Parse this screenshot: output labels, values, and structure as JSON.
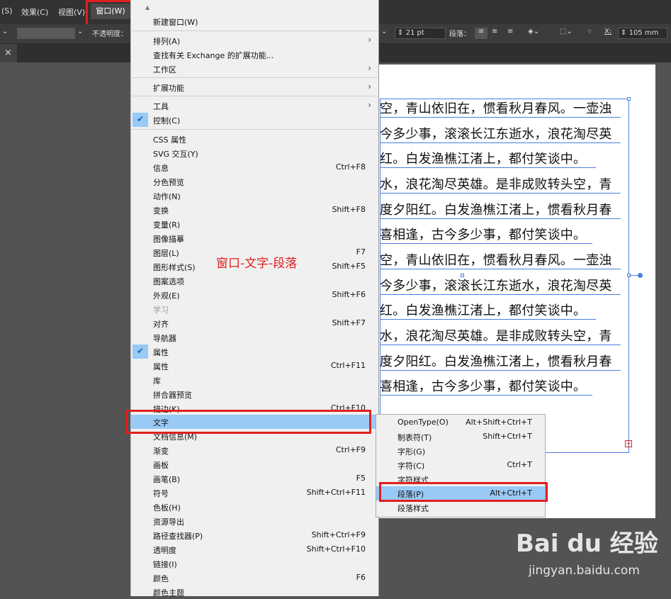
{
  "menubar": {
    "items": [
      "(S)",
      "效果(C)",
      "视图(V)"
    ],
    "window_label": "窗口(W)"
  },
  "controlbar": {
    "opacity_label": "不透明度：",
    "font_size": "21 pt",
    "paragraph_label": "段落：",
    "x_label": "X:",
    "x_value": "105 mm"
  },
  "tab": {
    "close": "×"
  },
  "document_text": [
    "空，青山依旧在，惯看秋月春风。一壶浊",
    "今多少事，滚滚长江东逝水，浪花淘尽英",
    "红。白发渔樵江渚上，都付笑谈中。",
    "水，浪花淘尽英雄。是非成败转头空，青",
    "度夕阳红。白发渔樵江渚上，惯看秋月春",
    "喜相逢，古今多少事，都付笑谈中。",
    "空，青山依旧在，惯看秋月春风。一壶浊",
    "今多少事，滚滚长江东逝水，浪花淘尽英",
    "红。白发渔樵江渚上，都付笑谈中。",
    "水，浪花淘尽英雄。是非成败转头空，青",
    "度夕阳红。白发渔樵江渚上，惯看秋月春",
    "喜相逢，古今多少事，都付笑谈中。"
  ],
  "window_menu": {
    "scroll_up": "▲",
    "items": [
      {
        "label": "新建窗口(W)",
        "shortcut": ""
      },
      {
        "label": "排列(A)",
        "shortcut": "",
        "submenu": true
      },
      {
        "label": "查找有关 Exchange 的扩展功能...",
        "shortcut": ""
      },
      {
        "label": "工作区",
        "shortcut": "",
        "submenu": true
      },
      {
        "label": "扩展功能",
        "shortcut": "",
        "submenu": true
      },
      {
        "label": "工具",
        "shortcut": "",
        "submenu": true
      },
      {
        "label": "控制(C)",
        "shortcut": "",
        "checked": true
      },
      {
        "label": "CSS 属性",
        "shortcut": ""
      },
      {
        "label": "SVG 交互(Y)",
        "shortcut": ""
      },
      {
        "label": "信息",
        "shortcut": "Ctrl+F8"
      },
      {
        "label": "分色预览",
        "shortcut": ""
      },
      {
        "label": "动作(N)",
        "shortcut": ""
      },
      {
        "label": "变换",
        "shortcut": "Shift+F8"
      },
      {
        "label": "变量(R)",
        "shortcut": ""
      },
      {
        "label": "图像描摹",
        "shortcut": ""
      },
      {
        "label": "图层(L)",
        "shortcut": "F7"
      },
      {
        "label": "图形样式(S)",
        "shortcut": "Shift+F5"
      },
      {
        "label": "图案选项",
        "shortcut": ""
      },
      {
        "label": "外观(E)",
        "shortcut": "Shift+F6"
      },
      {
        "label": "学习",
        "shortcut": "",
        "disabled": true
      },
      {
        "label": "对齐",
        "shortcut": "Shift+F7"
      },
      {
        "label": "导航器",
        "shortcut": ""
      },
      {
        "label": "属性",
        "shortcut": "",
        "checked": true
      },
      {
        "label": "属性",
        "shortcut": "Ctrl+F11"
      },
      {
        "label": "库",
        "shortcut": ""
      },
      {
        "label": "拼合器预览",
        "shortcut": ""
      },
      {
        "label": "描边(K)",
        "shortcut": "Ctrl+F10"
      },
      {
        "label": "文字",
        "shortcut": "",
        "highlighted": true
      },
      {
        "label": "文档信息(M)",
        "shortcut": ""
      },
      {
        "label": "渐变",
        "shortcut": "Ctrl+F9"
      },
      {
        "label": "画板",
        "shortcut": ""
      },
      {
        "label": "画笔(B)",
        "shortcut": "F5"
      },
      {
        "label": "符号",
        "shortcut": "Shift+Ctrl+F11"
      },
      {
        "label": "色板(H)",
        "shortcut": ""
      },
      {
        "label": "资源导出",
        "shortcut": ""
      },
      {
        "label": "路径查找器(P)",
        "shortcut": "Shift+Ctrl+F9"
      },
      {
        "label": "透明度",
        "shortcut": "Shift+Ctrl+F10"
      },
      {
        "label": "链接(I)",
        "shortcut": ""
      },
      {
        "label": "颜色",
        "shortcut": "F6"
      },
      {
        "label": "颜色主题",
        "shortcut": ""
      }
    ]
  },
  "text_submenu": {
    "items": [
      {
        "label": "OpenType(O)",
        "shortcut": "Alt+Shift+Ctrl+T"
      },
      {
        "label": "制表符(T)",
        "shortcut": "Shift+Ctrl+T"
      },
      {
        "label": "字形(G)",
        "shortcut": ""
      },
      {
        "label": "字符(C)",
        "shortcut": "Ctrl+T"
      },
      {
        "label": "字符样式",
        "shortcut": ""
      },
      {
        "label": "段落(P)",
        "shortcut": "Alt+Ctrl+T",
        "highlighted": true
      },
      {
        "label": "段落样式",
        "shortcut": ""
      }
    ]
  },
  "annotation": "窗口-文字-段落",
  "watermark": {
    "logo": "Bai du 经验",
    "url": "jingyan.baidu.com"
  },
  "colors": {
    "highlight": "#99c9f5",
    "annotation_red": "#e02020",
    "menu_bg": "#f0f0f0"
  }
}
